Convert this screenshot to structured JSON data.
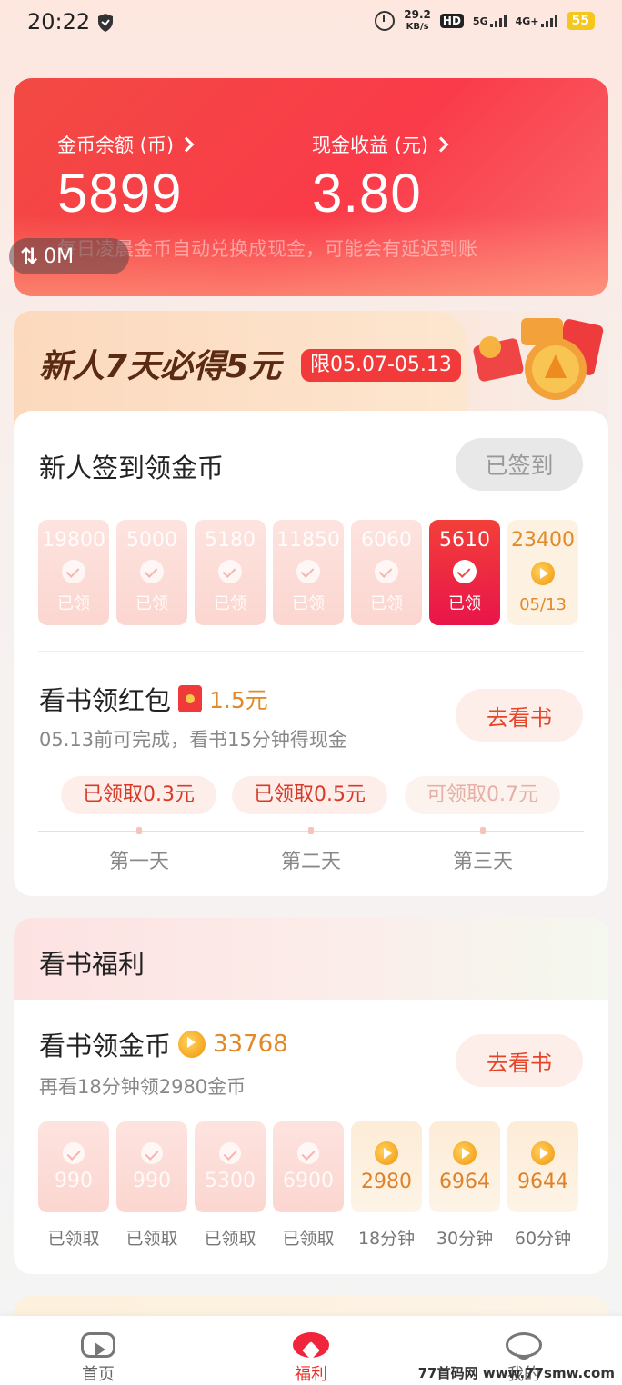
{
  "status_bar": {
    "time": "20:22",
    "speed_value": "29.2",
    "speed_unit": "KB/s",
    "hd": "HD",
    "net1": "5G",
    "net2": "4G+",
    "battery": "55"
  },
  "balance": {
    "coins_label": "金币余额 (币)",
    "coins_value": "5899",
    "cash_label": "现金收益 (元)",
    "cash_value": "3.80",
    "note": "每日凌晨金币自动兑换成现金，可能会有延迟到账",
    "sync_label": "0M"
  },
  "newcomer": {
    "title": "新人7天必得5元",
    "limit": "限05.07-05.13",
    "checkin_title": "新人签到领金币",
    "signed_label": "已签到",
    "days": [
      {
        "amount": "19800",
        "label": "已领",
        "state": "done"
      },
      {
        "amount": "5000",
        "label": "已领",
        "state": "done"
      },
      {
        "amount": "5180",
        "label": "已领",
        "state": "done"
      },
      {
        "amount": "11850",
        "label": "已领",
        "state": "done"
      },
      {
        "amount": "6060",
        "label": "已领",
        "state": "done"
      },
      {
        "amount": "5610",
        "label": "已领",
        "state": "active"
      },
      {
        "amount": "23400",
        "label": "05/13",
        "state": "future"
      }
    ],
    "read_task": {
      "title": "看书领红包",
      "amount": "1.5元",
      "sub": "05.13前可完成，看书15分钟得现金",
      "button": "去看书",
      "rewards": [
        "已领取0.3元",
        "已领取0.5元",
        "可领取0.7元"
      ],
      "day_labels": [
        "第一天",
        "第二天",
        "第三天"
      ]
    }
  },
  "benefits": {
    "header": "看书福利",
    "task_title": "看书领金币",
    "task_amount": "33768",
    "task_sub": "再看18分钟领2980金币",
    "button": "去看书",
    "tiles": [
      {
        "amount": "990",
        "caption": "已领取",
        "state": "done"
      },
      {
        "amount": "990",
        "caption": "已领取",
        "state": "done"
      },
      {
        "amount": "5300",
        "caption": "已领取",
        "state": "done"
      },
      {
        "amount": "6900",
        "caption": "已领取",
        "state": "done"
      },
      {
        "amount": "2980",
        "caption": "18分钟",
        "state": "future"
      },
      {
        "amount": "6964",
        "caption": "30分钟",
        "state": "future"
      },
      {
        "amount": "9644",
        "caption": "60分钟",
        "state": "future"
      }
    ]
  },
  "nav": {
    "home": "首页",
    "welfare": "福利",
    "me": "我的"
  },
  "watermark": "77首码网 www.77smw.com"
}
